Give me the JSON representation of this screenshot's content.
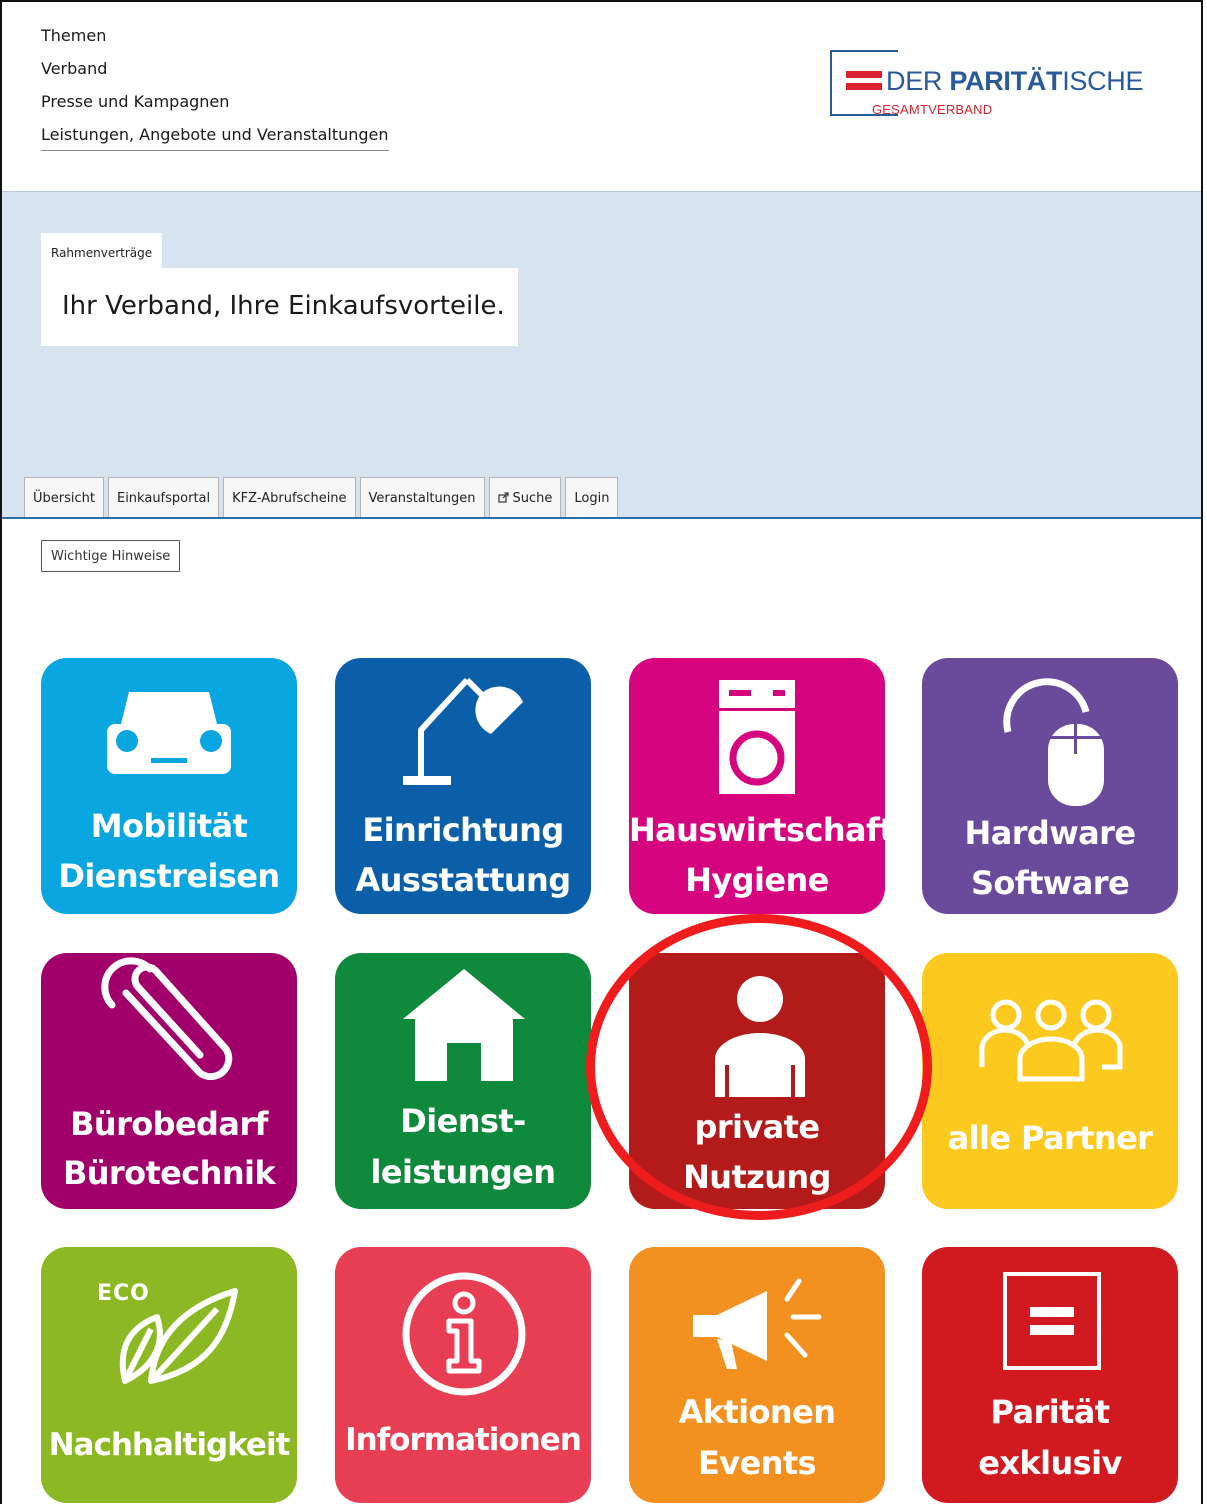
{
  "nav": {
    "items": [
      "Themen",
      "Verband",
      "Presse und Kampagnen",
      "Leistungen, Angebote und Veranstaltungen"
    ]
  },
  "logo": {
    "word_regular": "DER ",
    "word_bold": "PARITÄT",
    "word_tail": "ISCHE",
    "subtitle": "GESAMTVERBAND",
    "colors": {
      "blue": "#2a5a9c",
      "red": "#d9212f"
    }
  },
  "hero": {
    "tag": "Rahmenverträge",
    "headline": "Ihr Verband, Ihre Einkaufsvorteile.",
    "background": "#d7e4ef"
  },
  "tabs": [
    "Übersicht",
    "Einkaufsportal",
    "KFZ-Abrufscheine",
    "Veranstaltungen",
    "Suche",
    "Login"
  ],
  "search_tab_icon": "external-link-icon",
  "hint_button": "Wichtige Hinweise",
  "tiles": [
    {
      "line1": "Mobilität",
      "line2": "Dienstreisen",
      "color": "#0aa6e0",
      "icon": "car-icon"
    },
    {
      "line1": "Einrichtung",
      "line2": "Ausstattung",
      "color": "#0b5ea8",
      "icon": "desk-lamp-icon"
    },
    {
      "line1": "Hauswirtschaft",
      "line2": "Hygiene",
      "color": "#d6057f",
      "icon": "washing-machine-icon"
    },
    {
      "line1": "Hardware",
      "line2": "Software",
      "color": "#6a4a9b",
      "icon": "computer-mouse-icon"
    },
    {
      "line1": "Bürobedarf",
      "line2": "Bürotechnik",
      "color": "#a1006b",
      "icon": "paperclip-icon"
    },
    {
      "line1": "Dienst-",
      "line2": "leistungen",
      "color": "#0f8a3c",
      "icon": "house-icon"
    },
    {
      "line1": "private",
      "line2": "Nutzung",
      "color": "#b31b1b",
      "icon": "person-icon"
    },
    {
      "line1": "alle Partner",
      "line2": "",
      "color": "#fcc91e",
      "icon": "group-icon"
    },
    {
      "line1": "Nachhaltigkeit",
      "line2": "",
      "color": "#8cb823",
      "icon": "eco-leaf-icon",
      "badge": "ECO"
    },
    {
      "line1": "Informationen",
      "line2": "",
      "color": "#e73e53",
      "icon": "info-icon"
    },
    {
      "line1": "Aktionen",
      "line2": "Events",
      "color": "#f29120",
      "icon": "megaphone-icon"
    },
    {
      "line1": "Parität",
      "line2": "exklusiv",
      "color": "#d11a1f",
      "icon": "paritaet-logo-icon"
    }
  ],
  "highlight": {
    "target": "private Nutzung",
    "color": "#ee1c1c"
  }
}
